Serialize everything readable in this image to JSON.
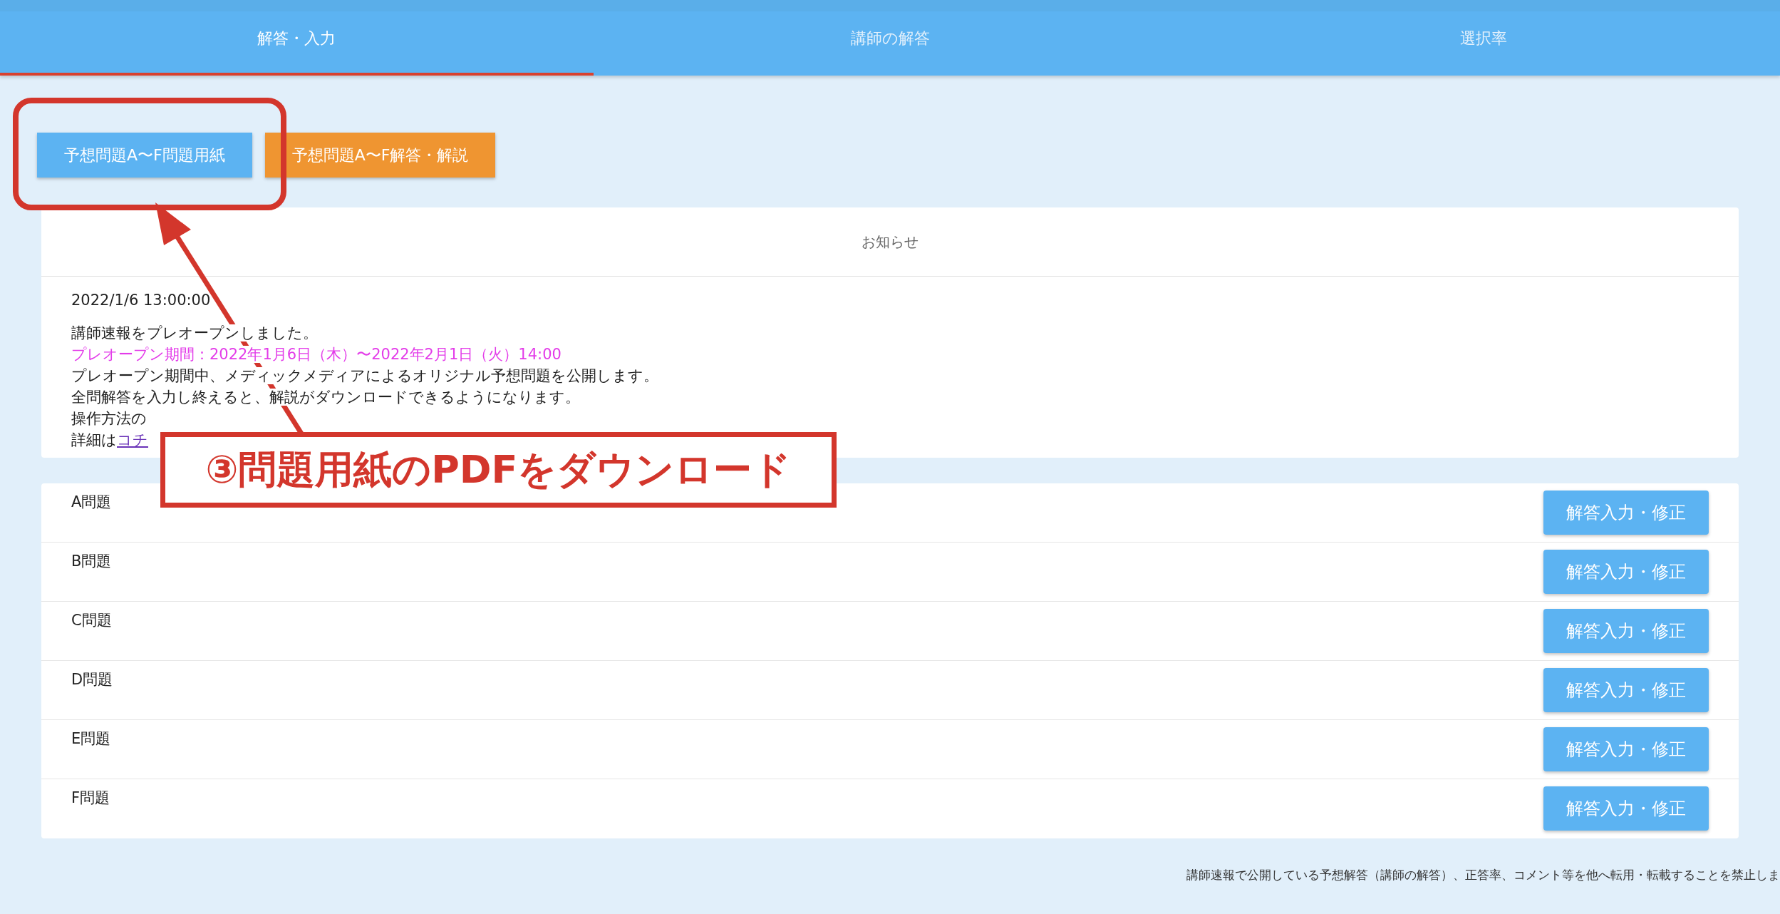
{
  "tabs": [
    {
      "label": "解答・入力",
      "selected": true
    },
    {
      "label": "講師の解答",
      "selected": false
    },
    {
      "label": "選択率",
      "selected": false
    }
  ],
  "actions": [
    {
      "label": "予想問題A〜F問題用紙",
      "kind": "primary"
    },
    {
      "label": "予想問題A〜F解答・解説",
      "kind": "secondary"
    }
  ],
  "notice": {
    "title": "お知らせ",
    "date": "2022/1/6 13:00:00",
    "lines": [
      {
        "text": "講師速報をプレオープンしました。",
        "kind": "plain"
      },
      {
        "text": "プレオープン期間：2022年1月6日（木）〜2022年2月1日（火）14:00",
        "kind": "highlight"
      },
      {
        "text": "プレオープン期間中、メディックメディアによるオリジナル予想問題を公開します。",
        "kind": "plain"
      },
      {
        "text": "全問解答を入力し終えると、解説がダウンロードできるようになります。",
        "kind": "plain"
      },
      {
        "text": "操作方法の",
        "kind": "plain"
      },
      {
        "text": "詳細は",
        "kind": "link",
        "link": "コチ"
      }
    ]
  },
  "problems": [
    {
      "name": "A問題",
      "button": "解答入力・修正"
    },
    {
      "name": "B問題",
      "button": "解答入力・修正"
    },
    {
      "name": "C問題",
      "button": "解答入力・修正"
    },
    {
      "name": "D問題",
      "button": "解答入力・修正"
    },
    {
      "name": "E問題",
      "button": "解答入力・修正"
    },
    {
      "name": "F問題",
      "button": "解答入力・修正"
    }
  ],
  "footer": "講師速報で公開している予想解答（講師の解答）、正答率、コメント等を他へ転用・転載することを禁止しま",
  "annotation": {
    "label": "③問題用紙のPDFをダウンロード"
  }
}
